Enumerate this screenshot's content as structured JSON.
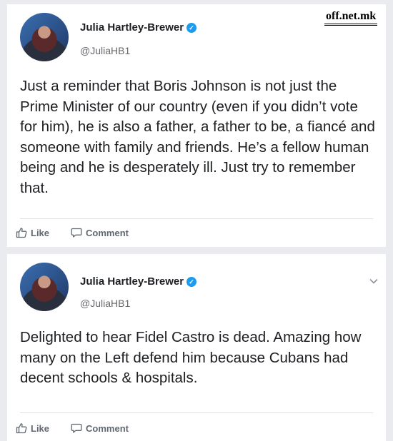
{
  "watermark": "off.net.mk",
  "posts": [
    {
      "author": "Julia Hartley-Brewer",
      "handle": "@JuliaHB1",
      "text": "Just a reminder that Boris Johnson is not just the Prime Minister of our country (even if you didn’t vote for him), he is also a father, a father to be, a fiancé and someone with family and friends. He’s a fellow human being and he is desperately ill. Just try to remember that.",
      "like_label": "Like",
      "comment_label": "Comment"
    },
    {
      "author": "Julia Hartley-Brewer",
      "handle": "@JuliaHB1",
      "text": "Delighted to hear Fidel Castro is dead. Amazing how many on the Left defend him because Cubans had decent schools & hospitals.",
      "like_label": "Like",
      "comment_label": "Comment"
    }
  ],
  "icons": {
    "verified": "verified-check-icon",
    "like": "thumbs-up-icon",
    "comment": "comment-bubble-icon",
    "menu": "chevron-down-icon"
  },
  "colors": {
    "verified": "#1d9bf0",
    "background": "#e9ebee",
    "text": "#1c1e21",
    "muted": "#65676b"
  }
}
